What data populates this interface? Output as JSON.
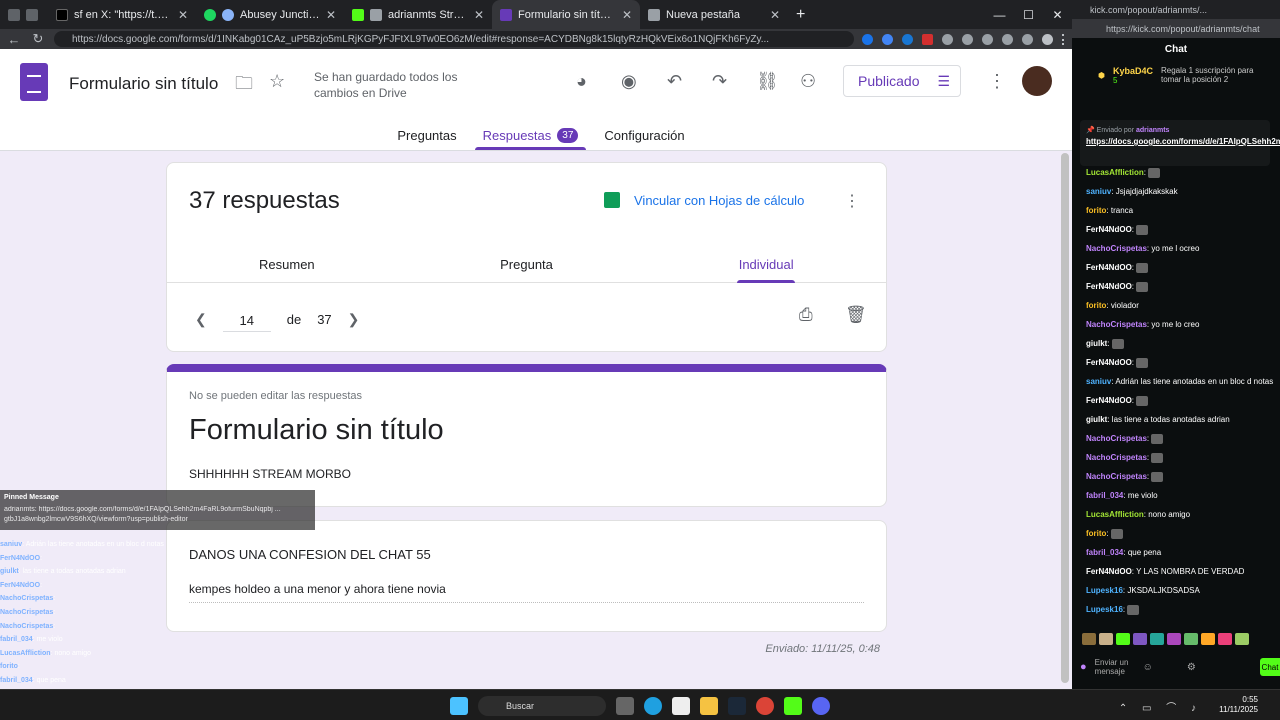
{
  "browser": {
    "tabs": [
      {
        "title": "sf en X: \"https://t.co/PXtSlpV0AL\"",
        "color": "#000000"
      },
      {
        "title": "Abusey Junction - Kokoroko",
        "color": "#1ed760"
      },
      {
        "title": "adrianmts Stream - Watch Live",
        "color": "#53fc18"
      },
      {
        "title": "Formulario sin título - Formulario",
        "color": "#673ab7"
      },
      {
        "title": "Nueva pestaña",
        "color": "#9aa0a6"
      }
    ],
    "url": "https://docs.google.com/forms/d/1INKabg01CAz_uP5Bzjo5mLRjKGPyFJFtXL9Tw0EO6zM/edit#response=ACYDBNg8k15lqtyRzHQkVEix6o1NQjFKh6FyZy..."
  },
  "forms": {
    "doc_title": "Formulario sin título",
    "save_status": "Se han guardado todos los cambios en Drive",
    "publish_label": "Publicado",
    "tabs": {
      "preguntas": "Preguntas",
      "respuestas": "Respuestas",
      "respuestas_count": "37",
      "configuracion": "Configuración"
    },
    "summary": {
      "count_label": "37 respuestas",
      "sheets_link": "Vincular con Hojas de cálculo",
      "subtabs": {
        "resumen": "Resumen",
        "pregunta": "Pregunta",
        "individual": "Individual"
      },
      "pager": {
        "current": "14",
        "of": "de",
        "total": "37"
      }
    },
    "response": {
      "note": "No se pueden editar las respuestas",
      "form_title": "Formulario sin título",
      "description": "SHHHHHH STREAM MORBO",
      "question": "DANOS UNA CONFESION DEL CHAT 55",
      "answer": "kempes holdeo a una menor y ahora tiene novia",
      "sent": "Enviado: 11/11/25, 0:48"
    }
  },
  "overlay": {
    "pinned_title": "Pinned Message",
    "pinned_text": "adrianmts: https://docs.google.com/forms/d/e/1FAIpQLSehh2m4FaRL9ofurmSbuNqpbj ... gtbJ1a8wnbg2lmcwV9S6hXQ/viewform?usp=publish-editor",
    "lines": [
      {
        "user": "saniuv",
        "text": "Adrián las tiene anotadas en un bloc d notas"
      },
      {
        "user": "FerN4NdOO",
        "text": ""
      },
      {
        "user": "giulkt",
        "text": "las tiene a todas anotadas adrian"
      },
      {
        "user": "FerN4NdOO",
        "text": ""
      },
      {
        "user": "NachoCrispetas",
        "text": ""
      },
      {
        "user": "NachoCrispetas",
        "text": ""
      },
      {
        "user": "NachoCrispetas",
        "text": ""
      },
      {
        "user": "fabril_034",
        "text": "me violo"
      },
      {
        "user": "LucasAffliction",
        "text": "nono amigo"
      },
      {
        "user": "forito",
        "text": ""
      },
      {
        "user": "fabril_034",
        "text": "que pena"
      },
      {
        "user": "FerN4NdOO",
        "text": "Y LAS NOMBRA DE VERDAD"
      },
      {
        "user": "Lupesk16",
        "text": "JKSDALJKDSADSA"
      }
    ]
  },
  "kick": {
    "url": "https://kick.com/popout/adrianmts/chat",
    "tab_url": "kick.com/popout/adrianmts/...",
    "chat_title": "Chat",
    "sub_user": "KybaD4C",
    "sub_count": "5",
    "sub_text": "Regala 1 suscripción para tomar la posición 2",
    "pinned_by": "Enviado por",
    "pinned_user": "adrianmts",
    "pinned_link": "https://docs.google.com/forms/d/e/1FAIpQLSehh2m4FaRL9ofurmSbuNqp...",
    "messages": [
      {
        "user": "LucasAffliction",
        "text": "",
        "c": "g"
      },
      {
        "user": "saniuv",
        "text": "Jsjajdjajdkakskak",
        "c": "b"
      },
      {
        "user": "forito",
        "text": "tranca",
        "c": "o"
      },
      {
        "user": "FerN4NdOO",
        "text": "",
        "c": "w"
      },
      {
        "user": "NachoCrispetas",
        "text": "yo me l ocreo",
        "c": "p"
      },
      {
        "user": "FerN4NdOO",
        "text": "",
        "c": "w"
      },
      {
        "user": "FerN4NdOO",
        "text": "",
        "c": "w"
      },
      {
        "user": "forito",
        "text": "violador",
        "c": "o"
      },
      {
        "user": "NachoCrispetas",
        "text": "yo me lo creo",
        "c": "p"
      },
      {
        "user": "giulkt",
        "text": "",
        "c": "w"
      },
      {
        "user": "FerN4NdOO",
        "text": "",
        "c": "w"
      },
      {
        "user": "saniuv",
        "text": "Adrián las tiene anotadas en un bloc d notas",
        "c": "b"
      },
      {
        "user": "FerN4NdOO",
        "text": "",
        "c": "w"
      },
      {
        "user": "giulkt",
        "text": "las tiene a todas anotadas adrian",
        "c": "w"
      },
      {
        "user": "NachoCrispetas",
        "text": "",
        "c": "p"
      },
      {
        "user": "NachoCrispetas",
        "text": "",
        "c": "p"
      },
      {
        "user": "NachoCrispetas",
        "text": "",
        "c": "p"
      },
      {
        "user": "fabril_034",
        "text": "me violo",
        "c": "p"
      },
      {
        "user": "LucasAffliction",
        "text": "nono amigo",
        "c": "g"
      },
      {
        "user": "forito",
        "text": "",
        "c": "o"
      },
      {
        "user": "fabril_034",
        "text": "que pena",
        "c": "p"
      },
      {
        "user": "FerN4NdOO",
        "text": "Y LAS NOMBRA DE VERDAD",
        "c": "w"
      },
      {
        "user": "Lupesk16",
        "text": "JKSDALJKDSADSA",
        "c": "b"
      },
      {
        "user": "Lupesk16",
        "text": "",
        "c": "b"
      }
    ],
    "input_placeholder": "Enviar un mensaje",
    "chat_button": "Chat"
  },
  "taskbar": {
    "search": "Buscar",
    "time": "0:55",
    "date": "11/11/2025"
  },
  "colors": {
    "purple": "#673ab7",
    "kick_green": "#53fc18"
  }
}
